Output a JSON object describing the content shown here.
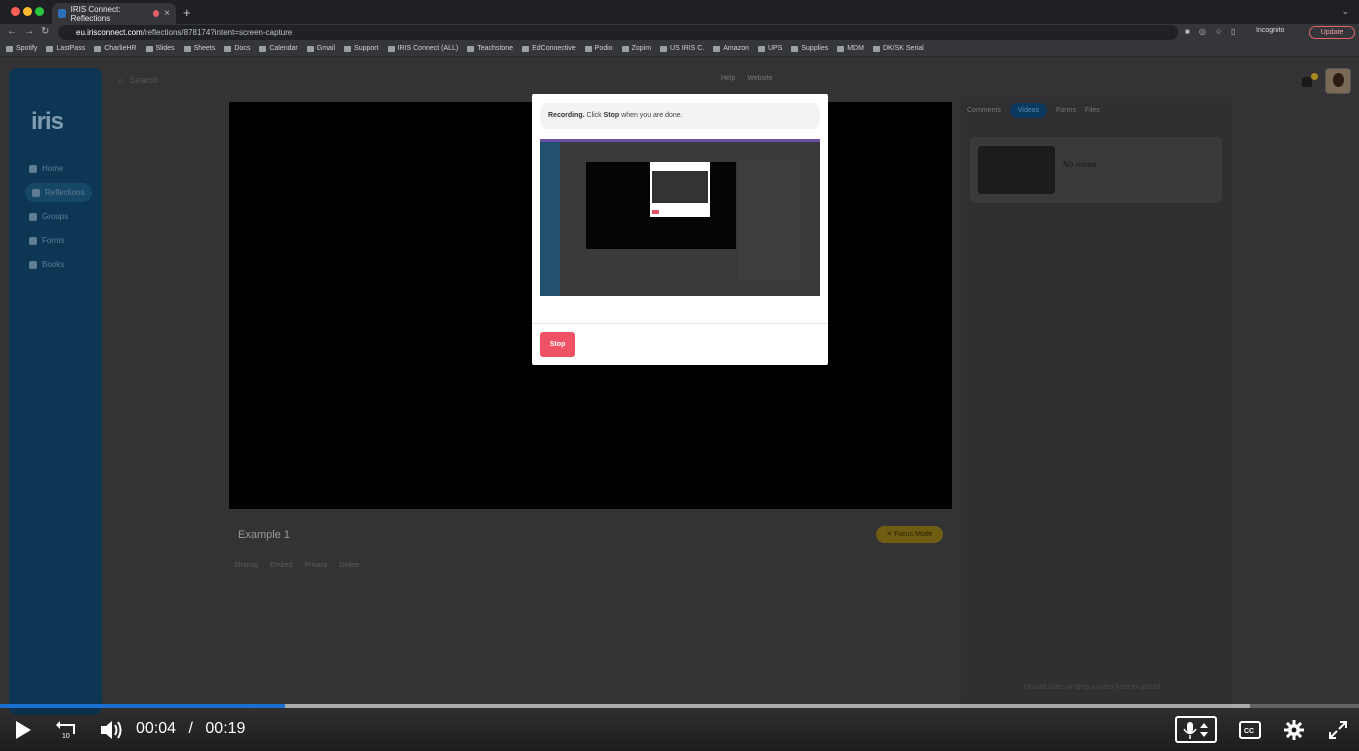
{
  "browser": {
    "tab_title": "IRIS Connect: Reflections",
    "url_host": "eu.irisconnect.com",
    "url_path": "/reflections/878174?intent=screen-capture",
    "profile_label": "Incognito",
    "update_label": "Update",
    "bookmarks": [
      "Spotify",
      "LastPass",
      "CharlieHR",
      "Slides",
      "Sheets",
      "Docs",
      "Calendar",
      "Gmail",
      "Support",
      "IRIS Connect (ALL)",
      "Teachstone",
      "EdConnective",
      "Podio",
      "Zopim",
      "US IRIS C.",
      "Amazon",
      "UPS",
      "Supplies",
      "MDM",
      "DK/SK Serial"
    ]
  },
  "app": {
    "logo": "iris",
    "nav": [
      "Home",
      "Reflections",
      "Groups",
      "Forms",
      "Books"
    ],
    "search_placeholder": "Search",
    "help_links": [
      "Help",
      "Website"
    ],
    "video_title": "Example 1",
    "focus_mode_label": "Focus Mode",
    "video_tabs": [
      "Sharing",
      "Embed",
      "Privacy",
      "Delete"
    ],
    "right_tabs": [
      "Comments",
      "Videos",
      "Forms",
      "Files"
    ],
    "video_card_name": "No name",
    "upload_hint": "Upload video or drop a video here to upload"
  },
  "modal": {
    "recording_bold": "Recording.",
    "recording_text_1": " Click ",
    "recording_stop_word": "Stop",
    "recording_text_2": " when you are done.",
    "stop_label": "Stop"
  },
  "player": {
    "current_time": "00:04",
    "separator": "/",
    "duration": "00:19",
    "progress": 0.21,
    "buffered": 0.92
  },
  "colors": {
    "accent": "#1a6fd0",
    "stop_button": "#ef5264",
    "sidebar": "#0c3654"
  }
}
